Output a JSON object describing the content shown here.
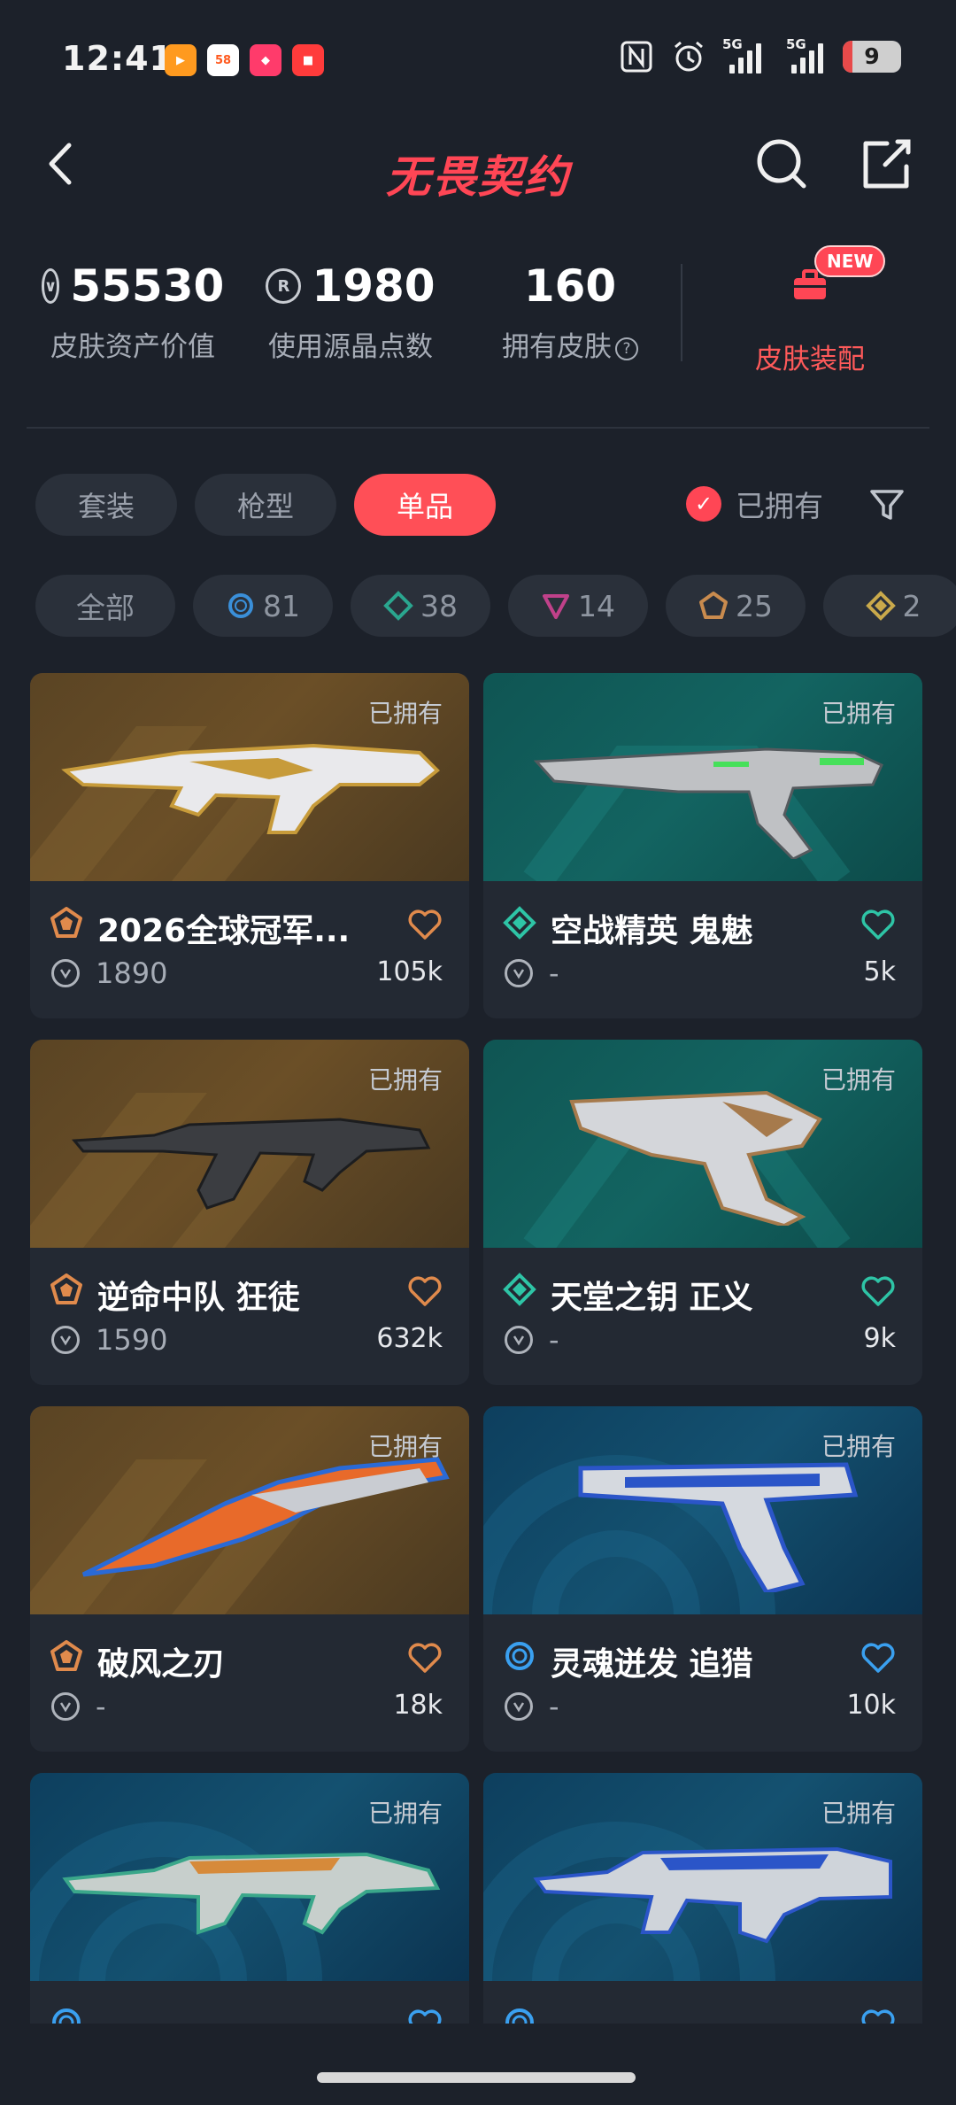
{
  "status_bar": {
    "time": "12:41",
    "apps": [
      {
        "icon": "video-app-icon",
        "text": "",
        "color": "#ff9a1f"
      },
      {
        "icon": "58-app-icon",
        "text": "58",
        "color": "#ffffff"
      },
      {
        "icon": "game-app-icon",
        "text": "",
        "color": "#ff3b6b"
      },
      {
        "icon": "news-app-icon",
        "text": "",
        "color": "#ff3b3b"
      }
    ],
    "signal_1_label": "5G",
    "signal_2_label": "5G",
    "battery_level": "9"
  },
  "header": {
    "title": "无畏契约"
  },
  "stats": {
    "asset_value": "55530",
    "asset_label": "皮肤资产价值",
    "radianite_value": "1980",
    "radianite_label": "使用源晶点数",
    "skin_count": "160",
    "skin_count_label": "拥有皮肤",
    "equip_label": "皮肤装配",
    "new_badge": "NEW"
  },
  "tabs": {
    "items": [
      "套装",
      "枪型",
      "单品"
    ],
    "active_index": 2,
    "owned_toggle_label": "已拥有",
    "owned_toggle_checked": true
  },
  "rarity_filters": [
    {
      "label": "全部",
      "icon": "",
      "color": ""
    },
    {
      "label": "81",
      "icon": "select-rarity-icon",
      "color": "#3a8fd9"
    },
    {
      "label": "38",
      "icon": "deluxe-rarity-icon",
      "color": "#2aa68f"
    },
    {
      "label": "14",
      "icon": "premium-rarity-icon",
      "color": "#c0418a"
    },
    {
      "label": "25",
      "icon": "exclusive-rarity-icon",
      "color": "#c98b4e"
    },
    {
      "label": "2",
      "icon": "ultra-rarity-icon",
      "color": "#c9a94b"
    }
  ],
  "cards": [
    {
      "name": "2026全球冠军...",
      "price": "1890",
      "favorites": "105k",
      "owned_label": "已拥有",
      "rarity": "exclusive",
      "rarity_color": "#e08a4c",
      "heart_color": "#e08a4c",
      "bg": "gold"
    },
    {
      "name": "空战精英 鬼魅",
      "price": "-",
      "favorites": "5k",
      "owned_label": "已拥有",
      "rarity": "deluxe",
      "rarity_color": "#2ec4a6",
      "heart_color": "#2ec4a6",
      "bg": "teal"
    },
    {
      "name": "逆命中队 狂徒",
      "price": "1590",
      "favorites": "632k",
      "owned_label": "已拥有",
      "rarity": "exclusive",
      "rarity_color": "#e08a4c",
      "heart_color": "#e08a4c",
      "bg": "gold"
    },
    {
      "name": "天堂之钥 正义",
      "price": "-",
      "favorites": "9k",
      "owned_label": "已拥有",
      "rarity": "deluxe",
      "rarity_color": "#2ec4a6",
      "heart_color": "#2ec4a6",
      "bg": "teal"
    },
    {
      "name": "破风之刃",
      "price": "-",
      "favorites": "18k",
      "owned_label": "已拥有",
      "rarity": "exclusive",
      "rarity_color": "#e08a4c",
      "heart_color": "#e08a4c",
      "bg": "gold"
    },
    {
      "name": "灵魂迸发 追猎",
      "price": "-",
      "favorites": "10k",
      "owned_label": "已拥有",
      "rarity": "select",
      "rarity_color": "#3aa0f0",
      "heart_color": "#3aa0f0",
      "bg": "blue"
    },
    {
      "name": "",
      "price": "",
      "favorites": "",
      "owned_label": "已拥有",
      "rarity": "select",
      "rarity_color": "#3aa0f0",
      "heart_color": "#3aa0f0",
      "bg": "blue"
    },
    {
      "name": "",
      "price": "",
      "favorites": "",
      "owned_label": "已拥有",
      "rarity": "select",
      "rarity_color": "#3aa0f0",
      "heart_color": "#3aa0f0",
      "bg": "blue"
    }
  ],
  "colors": {
    "accent": "#ff4655",
    "background": "#1c212a",
    "card": "#232933"
  }
}
